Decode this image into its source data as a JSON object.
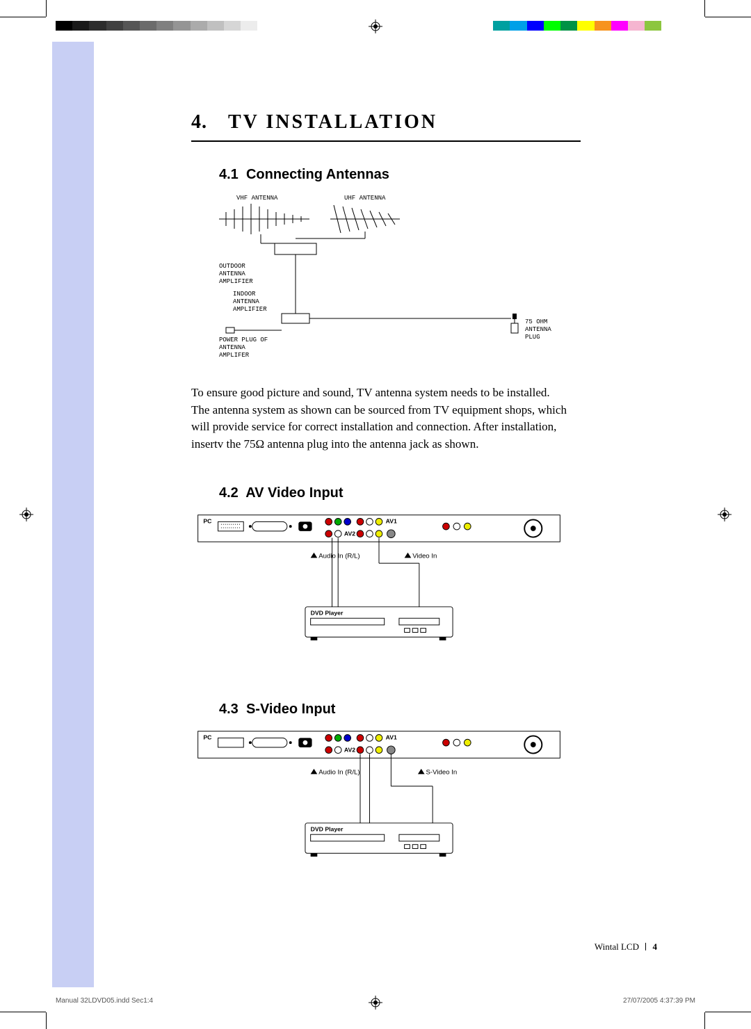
{
  "chapter": {
    "num": "4.",
    "title": "TV INSTALLATION"
  },
  "sec1": {
    "num": "4.1",
    "title": "Connecting Antennas"
  },
  "sec2": {
    "num": "4.2",
    "title": "AV Video Input"
  },
  "sec3": {
    "num": "4.3",
    "title": "S-Video Input"
  },
  "diagram1": {
    "vhf": "VHF ANTENNA",
    "uhf": "UHF ANTENNA",
    "outdoor": "OUTDOOR\nANTENNA\nAMPLIFIER",
    "indoor": "INDOOR\nANTENNA\nAMPLIFIER",
    "power": "POWER PLUG OF\nANTENNA\nAMPLIFER",
    "plug": "75 OHM\nANTENNA\nPLUG"
  },
  "diagram2": {
    "pc": "PC",
    "av1": "AV1",
    "av2": "AV2",
    "audio": "Audio In (R/L)",
    "video": "Video In",
    "dvd": "DVD Player"
  },
  "diagram3": {
    "pc": "PC",
    "av1": "AV1",
    "av2": "AV2",
    "audio": "Audio In (R/L)",
    "svideo": "S-Video In",
    "dvd": "DVD Player"
  },
  "body": "To ensure good picture and sound, TV antenna system needs to be installed. The antenna system as shown can be sourced from TV equipment shops, which will provide service for correct installation and connection. After installation, insertv the 75Ω antenna plug into the antenna jack as shown.",
  "footer": {
    "brand": "Wintal LCD",
    "page": "4"
  },
  "slug": {
    "file": "Manual 32LDVD05.indd   Sec1:4",
    "stamp": "27/07/2005   4:37:39 PM"
  },
  "colorbar": [
    "#000",
    "#1a1a1a",
    "#2d2d2d",
    "#404040",
    "#555",
    "#6b6b6b",
    "#808080",
    "#959595",
    "#ababab",
    "#c0c0c0",
    "#d6d6d6",
    "#ececec",
    "#fff",
    "#fff",
    "#fff",
    "#fff",
    "#fff",
    "#fff",
    "#fff",
    "#fff",
    "#fff",
    "#fff",
    "#fff",
    "#fff",
    "#fff",
    "#fff",
    "#00a0a0",
    "#00a0e8",
    "#00f",
    "#0f0",
    "#009245",
    "#ff0",
    "#f7931e",
    "#ff00ff",
    "#f5b5d0",
    "#8cc63f",
    "#fff",
    "#fff"
  ]
}
